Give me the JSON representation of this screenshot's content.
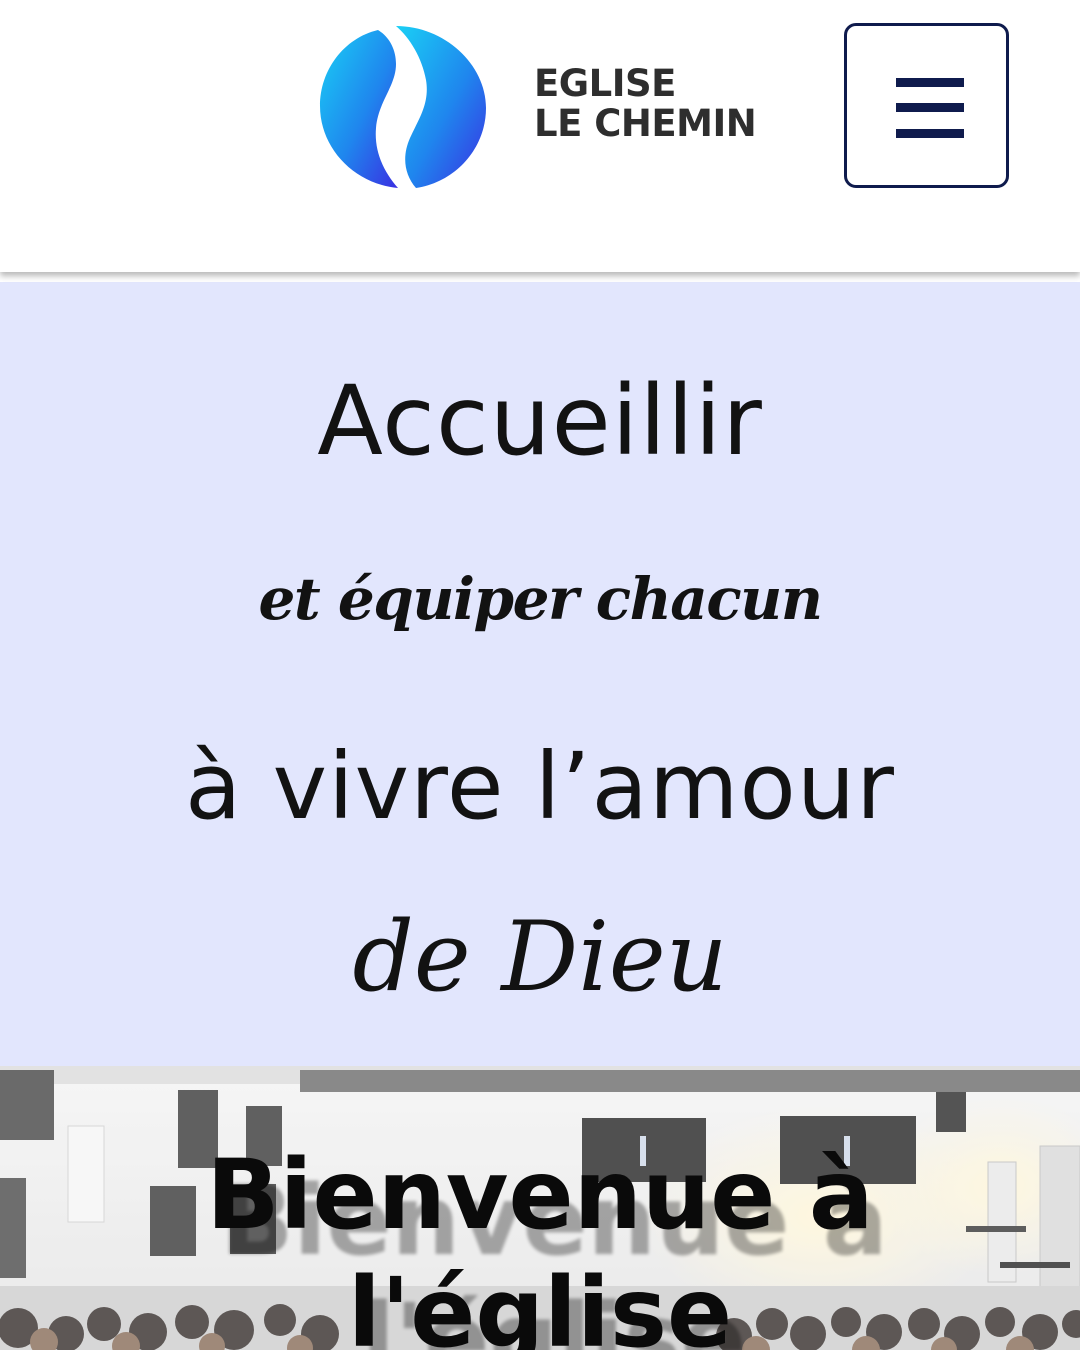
{
  "header": {
    "logo": {
      "line1": "EGLISE",
      "line2": "LE CHEMIN",
      "icon": "swoosh-circle-logo"
    },
    "menu_icon": "hamburger-menu-icon"
  },
  "hero": {
    "line1": "Accueillir",
    "line2": "et équiper chacun",
    "line3": "à vivre l’amour",
    "line4": "de Dieu",
    "background_color": "#e2e6fd"
  },
  "welcome": {
    "title_line1": "Bienvenue à",
    "title_line2": "l'église",
    "background_image": "church-congregation-photo"
  },
  "colors": {
    "brand_navy": "#0f1b4d",
    "logo_blue_dark": "#2a37e6",
    "logo_blue_light": "#22c8f2"
  }
}
